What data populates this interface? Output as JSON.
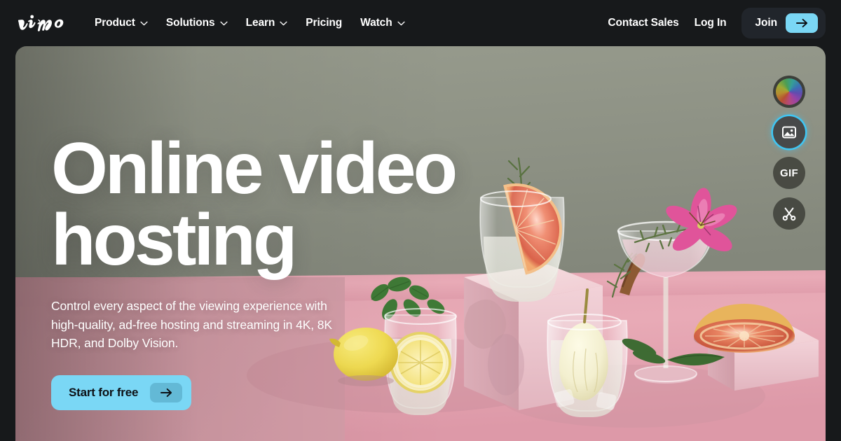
{
  "brand": {
    "name": "vimeo",
    "logo_icon": "vimeo-wordmark-logo"
  },
  "nav": {
    "items": [
      {
        "label": "Product",
        "has_dropdown": true,
        "icon": "chevron-down-icon"
      },
      {
        "label": "Solutions",
        "has_dropdown": true,
        "icon": "chevron-down-icon"
      },
      {
        "label": "Learn",
        "has_dropdown": true,
        "icon": "chevron-down-icon"
      },
      {
        "label": "Pricing",
        "has_dropdown": false,
        "icon": ""
      },
      {
        "label": "Watch",
        "has_dropdown": true,
        "icon": "chevron-down-icon"
      }
    ],
    "contact_sales": "Contact Sales",
    "log_in": "Log In",
    "join": "Join",
    "join_arrow_icon": "arrow-right-icon"
  },
  "hero": {
    "title_line1": "Online video",
    "title_line2": "hosting",
    "subtitle": "Control every aspect of the viewing experience with high-quality, ad-free hosting and streaming in 4K, 8K HDR, and Dolby Vision.",
    "cta_label": "Start for free",
    "cta_arrow_icon": "arrow-right-icon",
    "image_alt": "cocktail-drinks-still-life-photo"
  },
  "tool_rail": {
    "items": [
      {
        "name": "color-wheel-tool",
        "icon": "color-wheel-icon",
        "label": "",
        "active": false
      },
      {
        "name": "image-tool",
        "icon": "image-icon",
        "label": "",
        "active": true
      },
      {
        "name": "gif-tool",
        "icon": "gif-text-icon",
        "label": "GIF",
        "active": false
      },
      {
        "name": "trim-tool",
        "icon": "scissors-icon",
        "label": "",
        "active": false
      }
    ]
  },
  "colors": {
    "page_background": "#17191b",
    "accent_blue": "#7ad7f5",
    "accent_ring": "#3fc6f4",
    "join_pill": "#21252b",
    "wall_green": "#8d9184",
    "floor_pink": "#e8a8b4",
    "text_white": "#ffffff"
  }
}
